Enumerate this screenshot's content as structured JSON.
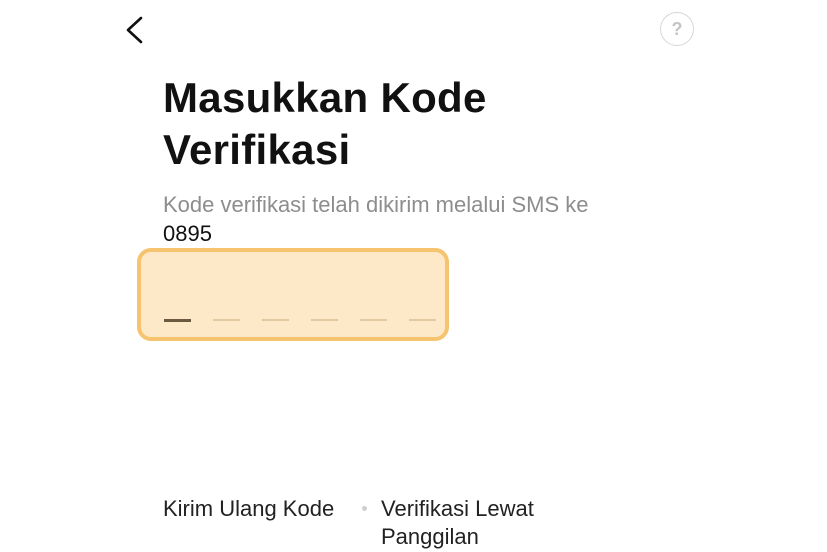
{
  "header": {
    "back_icon": "chevron-left-icon",
    "help_label": "?",
    "help_icon": "question-circle-icon"
  },
  "main": {
    "title": "Masukkan Kode Verifikasi",
    "subtitle": "Kode verifikasi telah dikirim melalui SMS ke",
    "phone_number": "0895"
  },
  "otp": {
    "length": 6,
    "active_index": 0,
    "colors": {
      "background": "#fde8c7",
      "border": "#f6c46f",
      "active_slot": "#6b5a40",
      "inactive_slot": "#e2c9a2"
    }
  },
  "footer": {
    "resend_label": "Kirim Ulang Kode",
    "call_label": "Verifikasi Lewat Panggilan"
  }
}
